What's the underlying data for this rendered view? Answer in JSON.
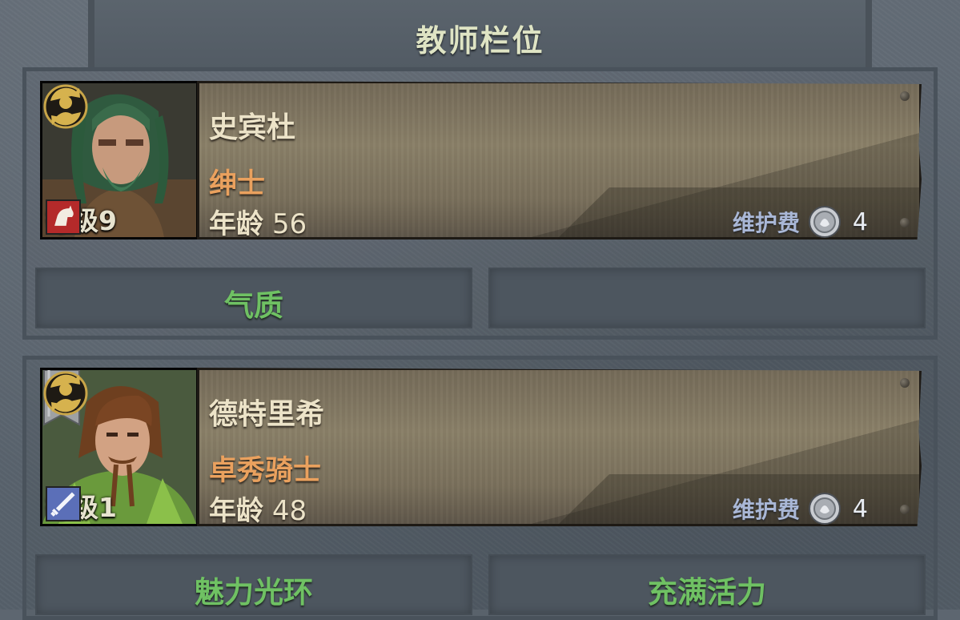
{
  "header": {
    "title": "教师栏位"
  },
  "teachers": [
    {
      "name": "史宾杜",
      "title": "绅士",
      "age_label": "年龄",
      "age": "56",
      "level_label": "等级",
      "level": "9",
      "class_icon": "horse-head-icon",
      "upkeep_label": "维护费",
      "upkeep_value": "4",
      "traits": [
        "气质",
        ""
      ]
    },
    {
      "name": "德特里希",
      "title": "卓秀骑士",
      "age_label": "年龄",
      "age": "48",
      "level_label": "等级",
      "level": "1",
      "class_icon": "sword-icon",
      "upkeep_label": "维护费",
      "upkeep_value": "4",
      "traits": [
        "魅力光环",
        "充满活力"
      ]
    }
  ],
  "colors": {
    "name": "#ece3c8",
    "title": "#eaa15e",
    "trait": "#6fc163",
    "upkeep_label": "#a9b7d6",
    "header_title": "#dfe4c4"
  }
}
